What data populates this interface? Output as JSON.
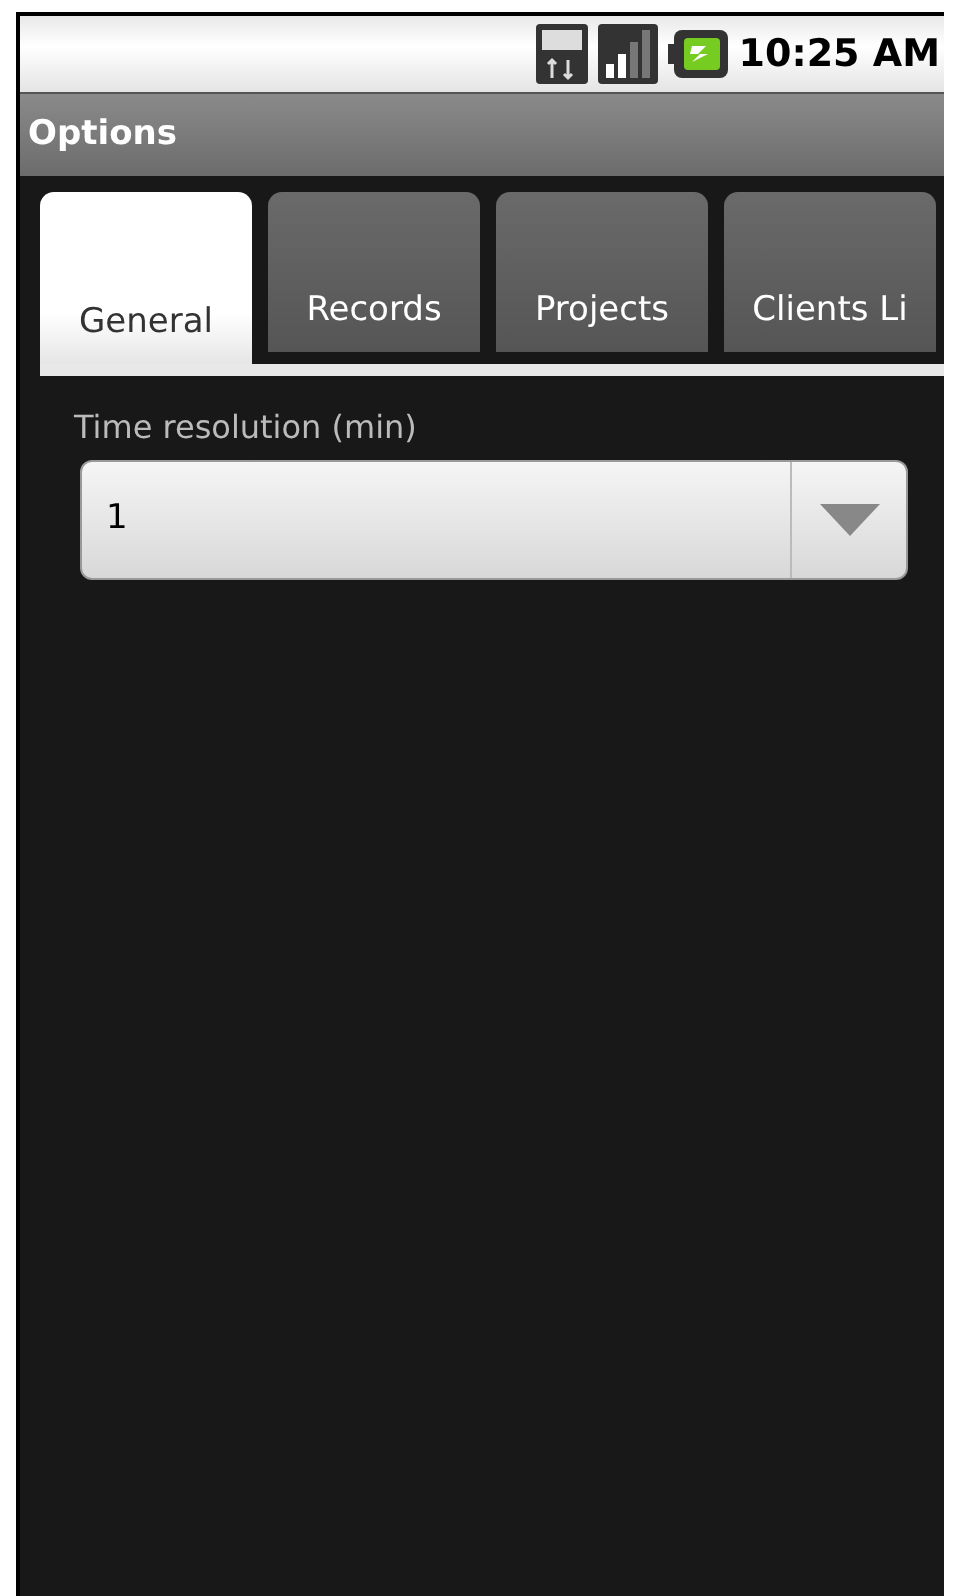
{
  "status_bar": {
    "time": "10:25 AM"
  },
  "title_bar": {
    "title": "Options"
  },
  "tabs": [
    {
      "label": "General",
      "selected": true
    },
    {
      "label": "Records",
      "selected": false
    },
    {
      "label": "Projects",
      "selected": false
    },
    {
      "label": "Clients Li",
      "selected": false
    }
  ],
  "setting": {
    "label": "Time resolution (min)",
    "value": "1"
  }
}
